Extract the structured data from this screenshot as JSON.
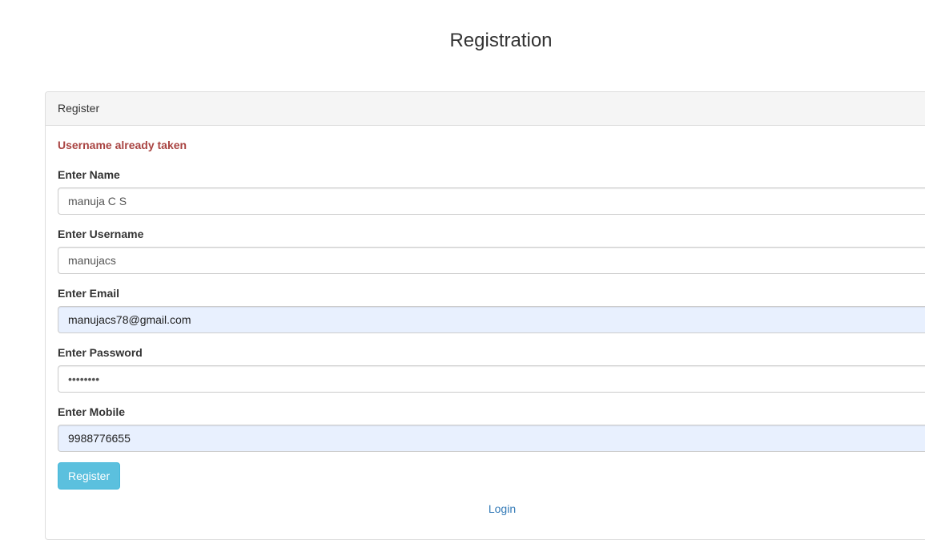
{
  "page": {
    "title": "Registration"
  },
  "panel": {
    "heading": "Register",
    "error": "Username already taken"
  },
  "form": {
    "name": {
      "label": "Enter Name",
      "value": "manuja C S"
    },
    "username": {
      "label": "Enter Username",
      "value": "manujacs"
    },
    "email": {
      "label": "Enter Email",
      "value": "manujacs78@gmail.com",
      "autofilled": true
    },
    "password": {
      "label": "Enter Password",
      "value": "********"
    },
    "mobile": {
      "label": "Enter Mobile",
      "value": "9988776655",
      "autofilled": true
    },
    "submit_label": "Register",
    "login_label": "Login"
  },
  "colors": {
    "error": "#a94442",
    "button": "#5bc0de",
    "link": "#337ab7",
    "autofill_bg": "#e8f0fe"
  }
}
